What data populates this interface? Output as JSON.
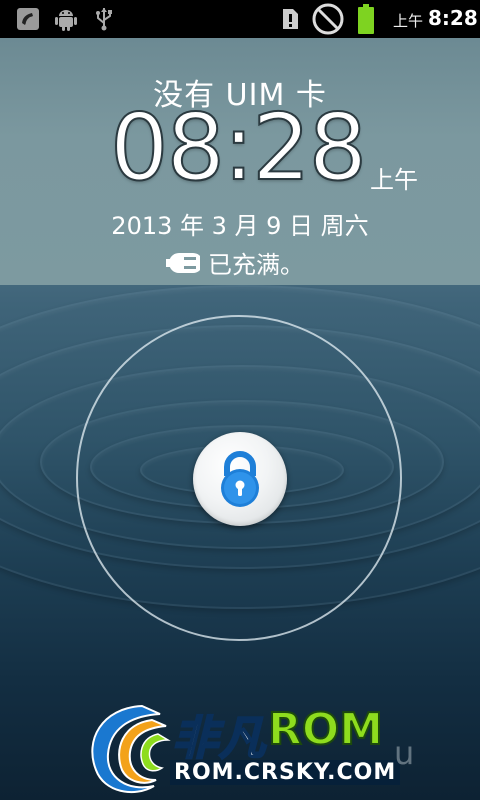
{
  "status_bar": {
    "icons": [
      "missed-call-icon",
      "android-debug-icon",
      "usb-icon",
      "alert-icon",
      "no-signal-icon",
      "battery-full-icon"
    ],
    "ampm": "上午",
    "time": "8:28"
  },
  "lockscreen": {
    "carrier": "没有 UIM 卡",
    "clock": {
      "time": "08:28",
      "ampm": "上午"
    },
    "date": "2013 年 3 月 9 日 周六",
    "charging": {
      "icon": "charging-plug-icon",
      "text": "已充满。"
    },
    "unlock": {
      "icon": "padlock-icon"
    }
  },
  "watermark": {
    "brand_cn": "非凡",
    "brand_en": "ROM",
    "url": "ROM.CRSKY.COM",
    "tail": "u"
  },
  "colors": {
    "accent_blue": "#1e7fd8",
    "battery_green": "#7ed321",
    "watermark_green": "#8edc1e"
  }
}
